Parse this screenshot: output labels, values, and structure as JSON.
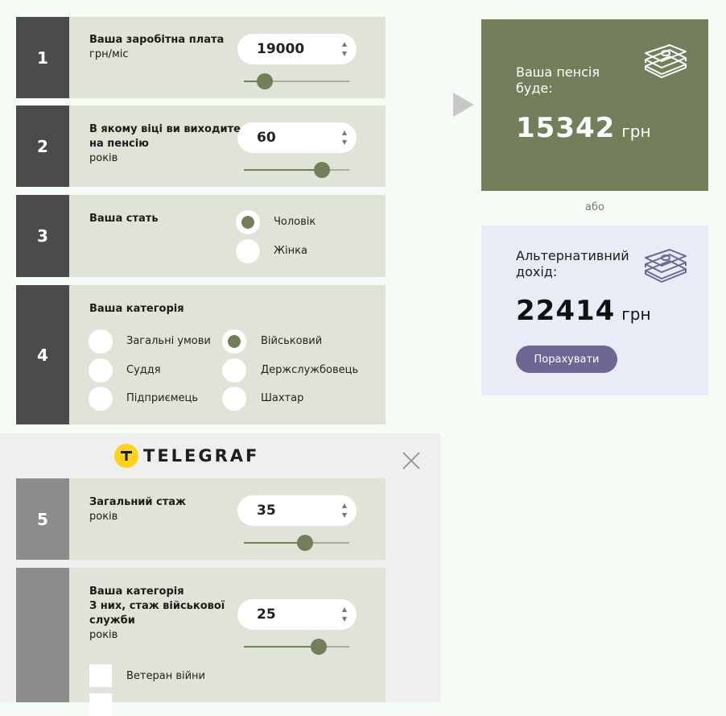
{
  "steps": [
    {
      "number": "1",
      "title": "Ваша заробітна плата",
      "subtitle": "грн/міс",
      "value": "19000",
      "slider_fraction": 0.2
    },
    {
      "number": "2",
      "title_line1": "В якому віці ви виходите",
      "title_line2": "на пенсію",
      "subtitle": "років",
      "value": "60",
      "slider_fraction": 0.74
    },
    {
      "number": "3",
      "title": "Ваша стать",
      "options": [
        {
          "label": "Чоловік",
          "selected": true
        },
        {
          "label": "Жінка",
          "selected": false
        }
      ]
    },
    {
      "number": "4",
      "title": "Ваша категорія",
      "options": [
        {
          "label": "Загальні умови",
          "selected": false
        },
        {
          "label": "Військовий",
          "selected": true
        },
        {
          "label": "Суддя",
          "selected": false
        },
        {
          "label": "Держслужбовець",
          "selected": false
        },
        {
          "label": "Підприємець",
          "selected": false
        },
        {
          "label": "Шахтар",
          "selected": false
        }
      ]
    },
    {
      "number": "5",
      "title": "Загальний стаж",
      "subtitle": "років",
      "value": "35",
      "slider_fraction": 0.58
    },
    {
      "title_line1": "Ваша категорія",
      "title_line2": "З них, стаж військової",
      "title_line3": "служби",
      "subtitle": "років",
      "value": "25",
      "slider_fraction": 0.71,
      "checkboxes": [
        {
          "label": "Ветеран війни",
          "checked": false
        }
      ]
    }
  ],
  "overlay": {
    "logo_text": "TELEGRAF",
    "close_icon": "close-icon"
  },
  "result": {
    "label_line1": "Ваша пенсія",
    "label_line2": "буде:",
    "value": "15342",
    "unit": "грн",
    "icon": "money-stack-icon",
    "bg": "#737f5b"
  },
  "separator": "або",
  "alternative": {
    "label_line1": "Альтернативний",
    "label_line2": "дохід:",
    "value": "22414",
    "unit": "грн",
    "button_label": "Порахувати",
    "icon": "money-stack-icon",
    "bg": "#e8ecf7",
    "accent": "#6e6793"
  }
}
